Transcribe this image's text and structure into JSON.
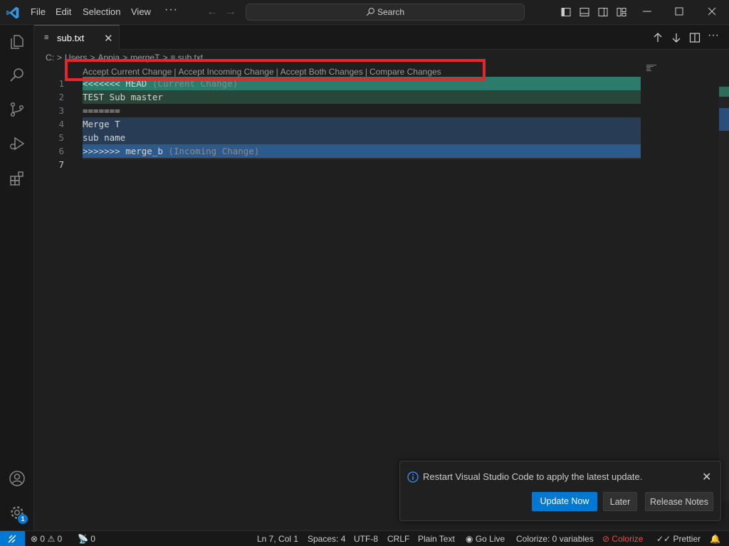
{
  "menu": {
    "file": "File",
    "edit": "Edit",
    "selection": "Selection",
    "view": "View",
    "more": "···"
  },
  "search": {
    "label": "Search"
  },
  "tab": {
    "label": "sub.txt",
    "file_icon": "≡",
    "close": "✕"
  },
  "breadcrumb": [
    "C:",
    ">",
    "Users",
    ">",
    "Appia",
    ">",
    "mergeT",
    ">",
    "≡ sub.txt"
  ],
  "codelens": {
    "accept_current": "Accept Current Change",
    "accept_incoming": "Accept Incoming Change",
    "accept_both": "Accept Both Changes",
    "compare": "Compare Changes",
    "separator": "|"
  },
  "lines": [
    {
      "num": "1",
      "text": "<<<<<<< HEAD",
      "suffix": " (Current Change)"
    },
    {
      "num": "2",
      "text": "TEST Sub master",
      "suffix": ""
    },
    {
      "num": "3",
      "text": "=======",
      "suffix": ""
    },
    {
      "num": "4",
      "text": "Merge T",
      "suffix": ""
    },
    {
      "num": "5",
      "text": "sub name",
      "suffix": ""
    },
    {
      "num": "6",
      "text": ">>>>>>> merge_b",
      "suffix": " (Incoming Change)"
    },
    {
      "num": "7",
      "text": "",
      "suffix": ""
    }
  ],
  "notification": {
    "message": "Restart Visual Studio Code to apply the latest update.",
    "update_now": "Update Now",
    "later": "Later",
    "release_notes": "Release Notes",
    "close": "✕"
  },
  "activity": {
    "settings_badge": "1"
  },
  "status": {
    "errors": "0",
    "warnings": "0",
    "ports": "0",
    "position": "Ln 7, Col 1",
    "spaces": "Spaces: 4",
    "encoding": "UTF-8",
    "eol": "CRLF",
    "language": "Plain Text",
    "go_live": "Go Live",
    "colorize_vars": "Colorize: 0 variables",
    "colorize": "Colorize",
    "prettier": "Prettier"
  },
  "colors": {
    "accent": "#0078d4",
    "current_change_header": "#2d7b6b",
    "current_change": "#294739",
    "incoming_change": "#293c55",
    "incoming_change_header": "#2d5a8c",
    "highlight_box": "#e8262a",
    "colorize_red": "#f14c4c"
  }
}
